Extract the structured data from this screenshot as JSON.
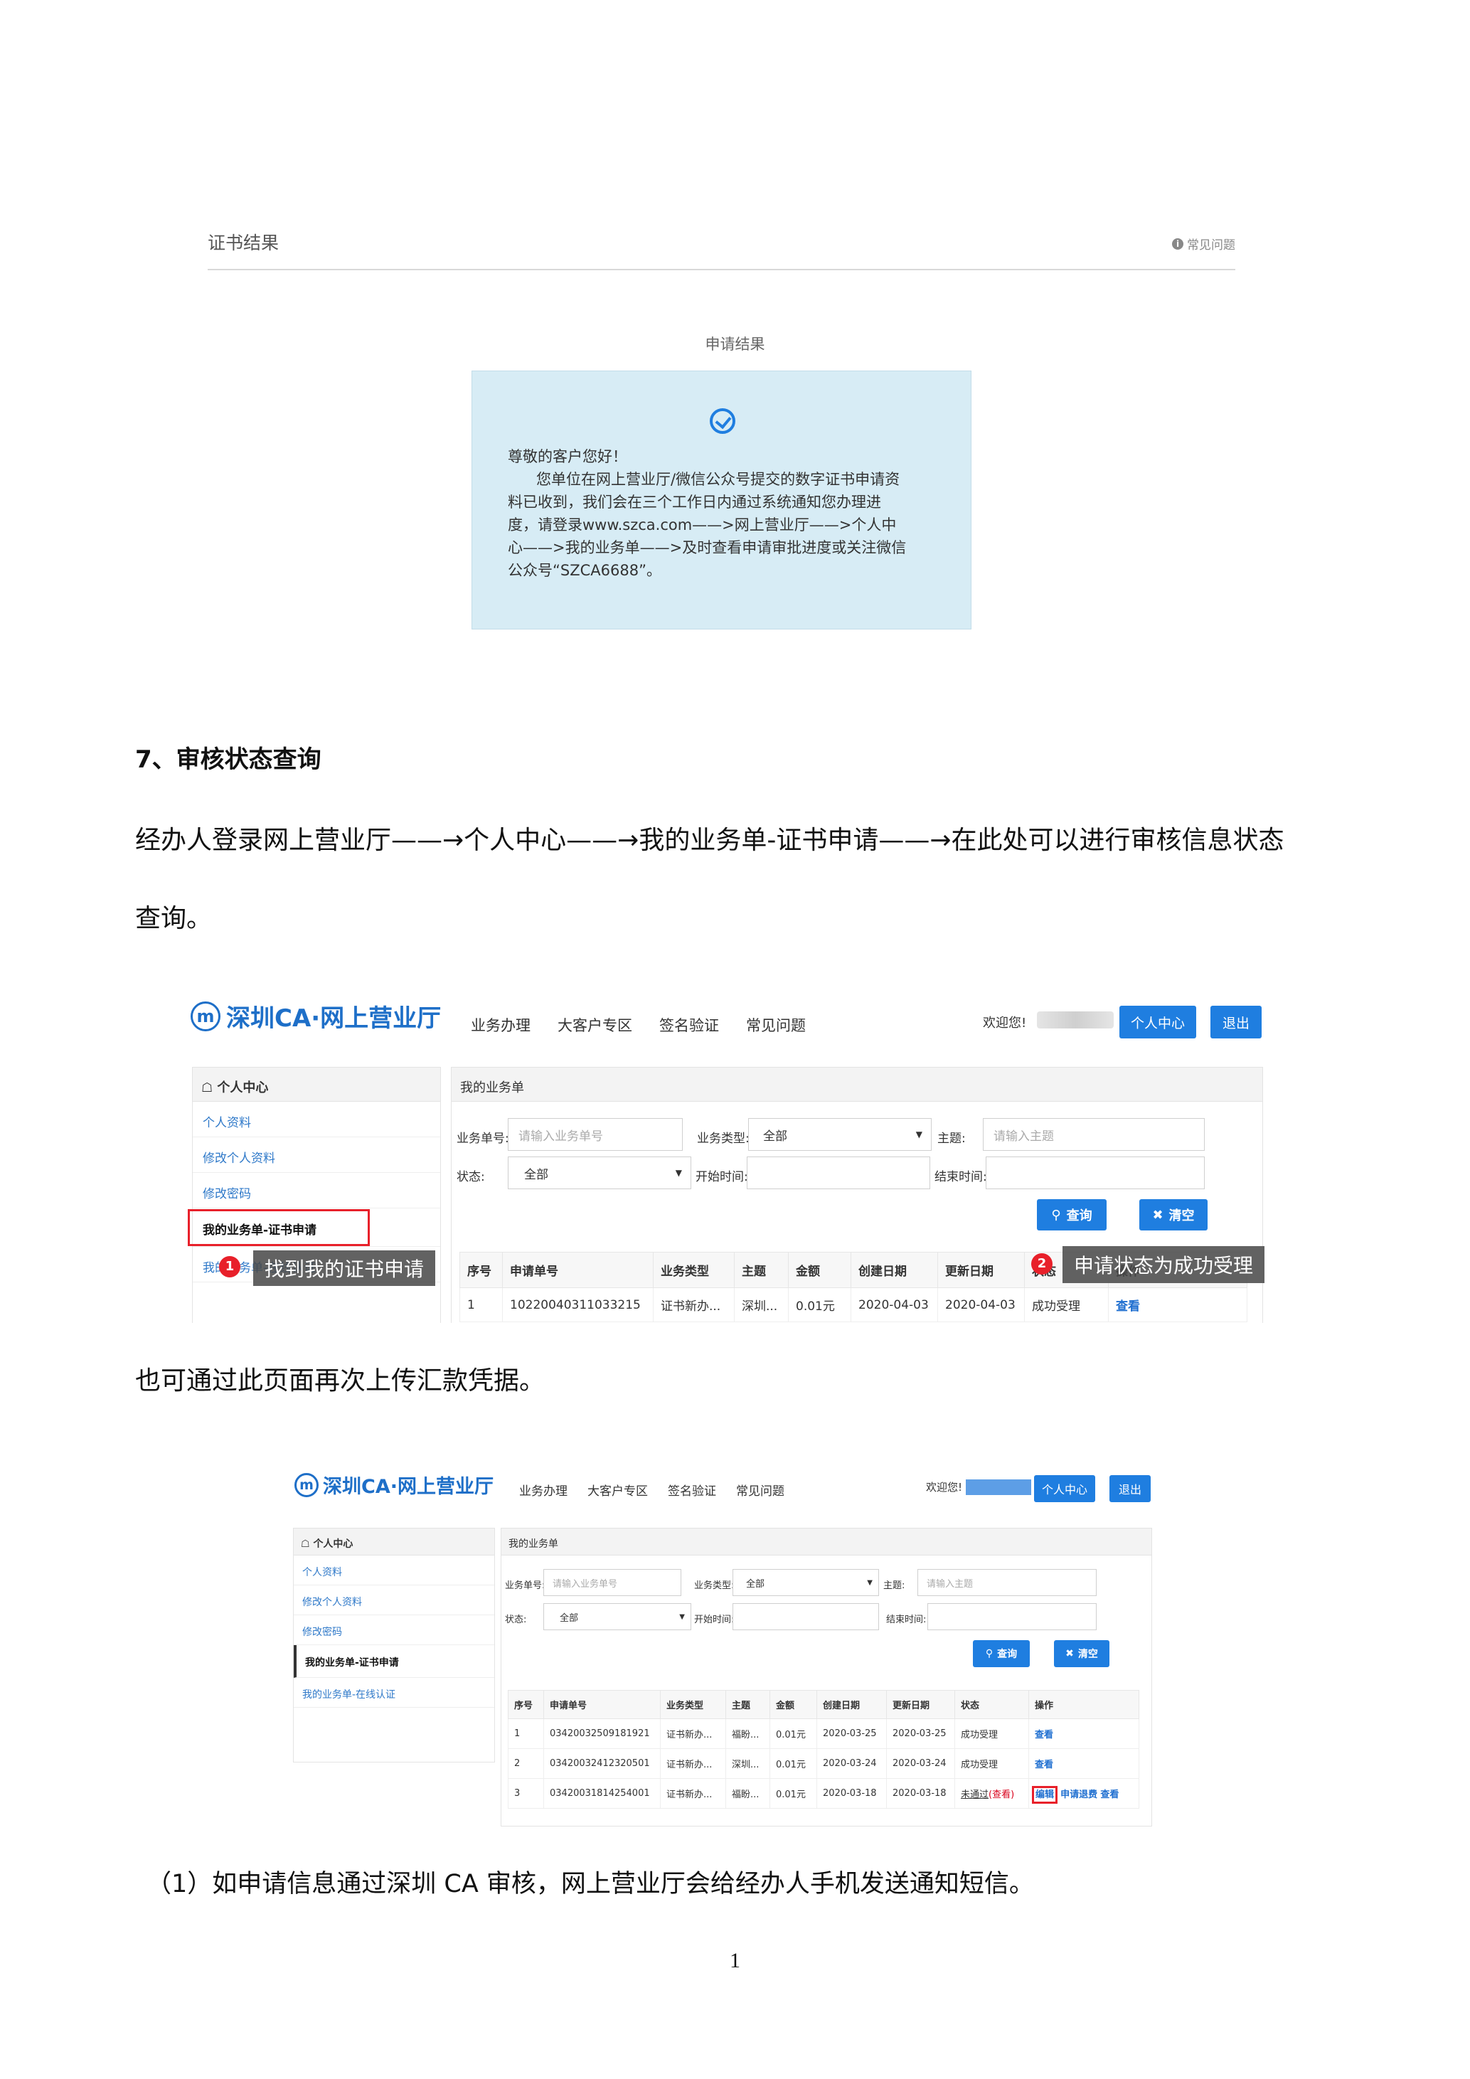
{
  "cert_result": {
    "title": "证书结果",
    "faq": "常见问题",
    "subtitle": "申请结果",
    "msg_line1": "尊敬的客户您好！",
    "msg_line2": "您单位在网上营业厅/微信公众号提交的数字证书申请资",
    "msg_line3": "料已收到，我们会在三个工作日内通过系统通知您办理进",
    "msg_line4": "度，请登录www.szca.com——>网上营业厅——>个人中",
    "msg_line5": "心——>我的业务单——>及时查看申请审批进度或关注微信",
    "msg_line6": "公众号“SZCA6688”。"
  },
  "section7": {
    "heading": "7、审核状态查询",
    "para_line1": "经办人登录网上营业厅——→个人中心——→我的业务单-证书申请——→在此处可以进行审核信息状态",
    "para_line2": "查询。"
  },
  "para_upload": "也可通过此页面再次上传汇款凭据。",
  "para_note": "（1）如申请信息通过深圳 CA 审核，网上营业厅会给经办人手机发送通知短信。",
  "page_number": "1",
  "portal": {
    "logo": "深圳CA·网上营业厅",
    "logo_mark": "m",
    "nav": [
      "业务办理",
      "大客户专区",
      "签名验证",
      "常见问题"
    ],
    "welcome": "欢迎您!",
    "btn_center": "个人中心",
    "btn_logout": "退出",
    "side_header": "个人中心",
    "side_items": [
      "个人资料",
      "修改个人资料",
      "修改密码",
      "我的业务单-证书申请",
      "我的业务单-在线认证"
    ],
    "panel_title": "我的业务单",
    "lbl_order": "业务单号:",
    "ph_order": "请输入业务单号",
    "lbl_type": "业务类型:",
    "val_type": "全部",
    "lbl_subject": "主题:",
    "ph_subject": "请输入主题",
    "lbl_status": "状态:",
    "val_status": "全部",
    "lbl_start": "开始时间:",
    "lbl_end": "结束时间:",
    "btn_search": "查询",
    "btn_clear": "清空",
    "columns": [
      "序号",
      "申请单号",
      "业务类型",
      "主题",
      "金额",
      "创建日期",
      "更新日期",
      "状态",
      "操作"
    ]
  },
  "shot1": {
    "rows": [
      [
        "1",
        "10220040311033215",
        "证书新办...",
        "深圳...",
        "0.01元",
        "2020-04-03",
        "2020-04-03",
        "成功受理",
        "查看"
      ]
    ],
    "tip1": "找到我的证书申请",
    "tip2": "申请状态为成功受理"
  },
  "shot2": {
    "rows": [
      [
        "1",
        "03420032509181921",
        "证书新办...",
        "福盼...",
        "0.01元",
        "2020-03-25",
        "2020-03-25",
        "成功受理",
        "查看"
      ],
      [
        "2",
        "03420032412320501",
        "证书新办...",
        "深圳...",
        "0.01元",
        "2020-03-24",
        "2020-03-24",
        "成功受理",
        "查看"
      ],
      [
        "3",
        "03420031814254001",
        "证书新办...",
        "福盼...",
        "0.01元",
        "2020-03-18",
        "2020-03-18",
        "未通过",
        "查看"
      ]
    ],
    "row3_status_link": "(查看)",
    "row3_action_edit": "编辑",
    "row3_action_refund": "申请退费"
  }
}
